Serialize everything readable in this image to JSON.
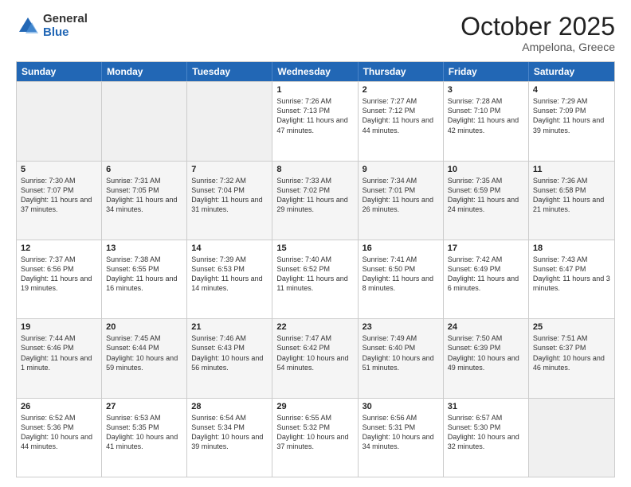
{
  "logo": {
    "general": "General",
    "blue": "Blue"
  },
  "header": {
    "month": "October 2025",
    "location": "Ampelona, Greece"
  },
  "days_of_week": [
    "Sunday",
    "Monday",
    "Tuesday",
    "Wednesday",
    "Thursday",
    "Friday",
    "Saturday"
  ],
  "weeks": [
    [
      {
        "day": "",
        "info": ""
      },
      {
        "day": "",
        "info": ""
      },
      {
        "day": "",
        "info": ""
      },
      {
        "day": "1",
        "info": "Sunrise: 7:26 AM\nSunset: 7:13 PM\nDaylight: 11 hours and 47 minutes."
      },
      {
        "day": "2",
        "info": "Sunrise: 7:27 AM\nSunset: 7:12 PM\nDaylight: 11 hours and 44 minutes."
      },
      {
        "day": "3",
        "info": "Sunrise: 7:28 AM\nSunset: 7:10 PM\nDaylight: 11 hours and 42 minutes."
      },
      {
        "day": "4",
        "info": "Sunrise: 7:29 AM\nSunset: 7:09 PM\nDaylight: 11 hours and 39 minutes."
      }
    ],
    [
      {
        "day": "5",
        "info": "Sunrise: 7:30 AM\nSunset: 7:07 PM\nDaylight: 11 hours and 37 minutes."
      },
      {
        "day": "6",
        "info": "Sunrise: 7:31 AM\nSunset: 7:05 PM\nDaylight: 11 hours and 34 minutes."
      },
      {
        "day": "7",
        "info": "Sunrise: 7:32 AM\nSunset: 7:04 PM\nDaylight: 11 hours and 31 minutes."
      },
      {
        "day": "8",
        "info": "Sunrise: 7:33 AM\nSunset: 7:02 PM\nDaylight: 11 hours and 29 minutes."
      },
      {
        "day": "9",
        "info": "Sunrise: 7:34 AM\nSunset: 7:01 PM\nDaylight: 11 hours and 26 minutes."
      },
      {
        "day": "10",
        "info": "Sunrise: 7:35 AM\nSunset: 6:59 PM\nDaylight: 11 hours and 24 minutes."
      },
      {
        "day": "11",
        "info": "Sunrise: 7:36 AM\nSunset: 6:58 PM\nDaylight: 11 hours and 21 minutes."
      }
    ],
    [
      {
        "day": "12",
        "info": "Sunrise: 7:37 AM\nSunset: 6:56 PM\nDaylight: 11 hours and 19 minutes."
      },
      {
        "day": "13",
        "info": "Sunrise: 7:38 AM\nSunset: 6:55 PM\nDaylight: 11 hours and 16 minutes."
      },
      {
        "day": "14",
        "info": "Sunrise: 7:39 AM\nSunset: 6:53 PM\nDaylight: 11 hours and 14 minutes."
      },
      {
        "day": "15",
        "info": "Sunrise: 7:40 AM\nSunset: 6:52 PM\nDaylight: 11 hours and 11 minutes."
      },
      {
        "day": "16",
        "info": "Sunrise: 7:41 AM\nSunset: 6:50 PM\nDaylight: 11 hours and 8 minutes."
      },
      {
        "day": "17",
        "info": "Sunrise: 7:42 AM\nSunset: 6:49 PM\nDaylight: 11 hours and 6 minutes."
      },
      {
        "day": "18",
        "info": "Sunrise: 7:43 AM\nSunset: 6:47 PM\nDaylight: 11 hours and 3 minutes."
      }
    ],
    [
      {
        "day": "19",
        "info": "Sunrise: 7:44 AM\nSunset: 6:46 PM\nDaylight: 11 hours and 1 minute."
      },
      {
        "day": "20",
        "info": "Sunrise: 7:45 AM\nSunset: 6:44 PM\nDaylight: 10 hours and 59 minutes."
      },
      {
        "day": "21",
        "info": "Sunrise: 7:46 AM\nSunset: 6:43 PM\nDaylight: 10 hours and 56 minutes."
      },
      {
        "day": "22",
        "info": "Sunrise: 7:47 AM\nSunset: 6:42 PM\nDaylight: 10 hours and 54 minutes."
      },
      {
        "day": "23",
        "info": "Sunrise: 7:49 AM\nSunset: 6:40 PM\nDaylight: 10 hours and 51 minutes."
      },
      {
        "day": "24",
        "info": "Sunrise: 7:50 AM\nSunset: 6:39 PM\nDaylight: 10 hours and 49 minutes."
      },
      {
        "day": "25",
        "info": "Sunrise: 7:51 AM\nSunset: 6:37 PM\nDaylight: 10 hours and 46 minutes."
      }
    ],
    [
      {
        "day": "26",
        "info": "Sunrise: 6:52 AM\nSunset: 5:36 PM\nDaylight: 10 hours and 44 minutes."
      },
      {
        "day": "27",
        "info": "Sunrise: 6:53 AM\nSunset: 5:35 PM\nDaylight: 10 hours and 41 minutes."
      },
      {
        "day": "28",
        "info": "Sunrise: 6:54 AM\nSunset: 5:34 PM\nDaylight: 10 hours and 39 minutes."
      },
      {
        "day": "29",
        "info": "Sunrise: 6:55 AM\nSunset: 5:32 PM\nDaylight: 10 hours and 37 minutes."
      },
      {
        "day": "30",
        "info": "Sunrise: 6:56 AM\nSunset: 5:31 PM\nDaylight: 10 hours and 34 minutes."
      },
      {
        "day": "31",
        "info": "Sunrise: 6:57 AM\nSunset: 5:30 PM\nDaylight: 10 hours and 32 minutes."
      },
      {
        "day": "",
        "info": ""
      }
    ]
  ]
}
